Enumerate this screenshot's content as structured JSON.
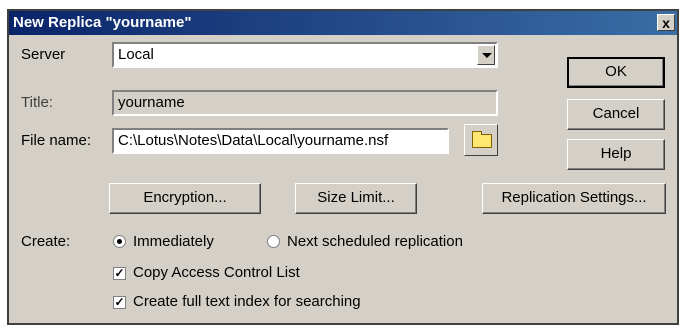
{
  "dialog": {
    "title": "New Replica \"yourname\"",
    "close_glyph": "x"
  },
  "form": {
    "server_label": "Server",
    "server_value": "Local",
    "title_label": "Title:",
    "title_value": "yourname",
    "filename_label": "File name:",
    "filename_value": "C:\\Lotus\\Notes\\Data\\Local\\yourname.nsf"
  },
  "buttons": {
    "ok": "OK",
    "cancel": "Cancel",
    "help": "Help",
    "encryption": "Encryption...",
    "size_limit": "Size Limit...",
    "replication_settings": "Replication Settings..."
  },
  "create": {
    "label": "Create:",
    "immediately": "Immediately",
    "next_scheduled": "Next scheduled replication",
    "selected": "immediately",
    "copy_acl": "Copy Access Control List",
    "copy_acl_checked": true,
    "fulltext": "Create full text index for searching",
    "fulltext_checked": true
  },
  "icons": {
    "folder": "folder-icon",
    "dropdown": "chevron-down-icon"
  }
}
